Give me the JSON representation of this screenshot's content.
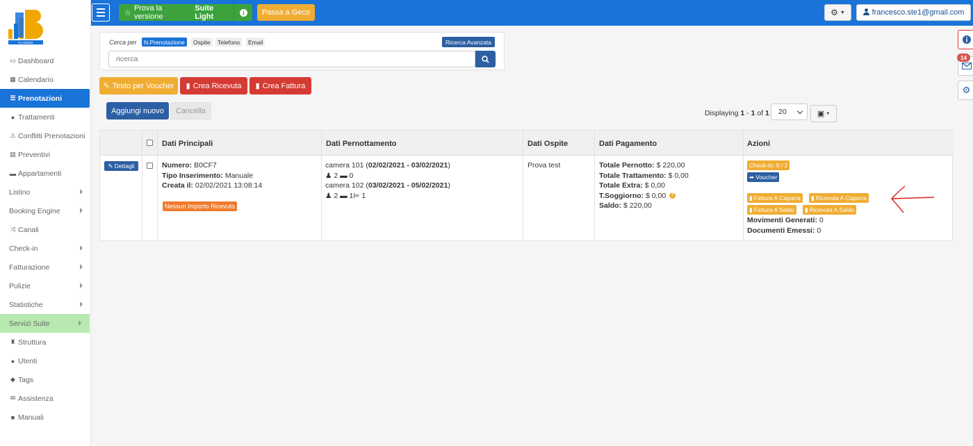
{
  "app": {
    "logo_text": "PLANNER"
  },
  "sidebar": {
    "items": [
      {
        "label": "Dashboard",
        "icon": "monitor-icon"
      },
      {
        "label": "Calendario",
        "icon": "calendar-icon"
      },
      {
        "label": "Prenotazioni",
        "icon": "list-icon",
        "active": true
      },
      {
        "label": "Trattamenti",
        "icon": "apple-icon"
      },
      {
        "label": "Conflitti Prenotazioni",
        "icon": "warning-icon"
      },
      {
        "label": "Preventivi",
        "icon": "document-icon"
      },
      {
        "label": "Appartamenti",
        "icon": "bed-icon"
      },
      {
        "label": "Listino",
        "submenu": true
      },
      {
        "label": "Booking Engine",
        "submenu": true
      },
      {
        "label": "Canali",
        "icon": "shuffle-icon"
      },
      {
        "label": "Check-in",
        "submenu": true
      },
      {
        "label": "Fatturazione",
        "submenu": true
      },
      {
        "label": "Pulizie",
        "submenu": true
      },
      {
        "label": "Statistiche",
        "submenu": true
      },
      {
        "label": "Servizi Suite",
        "submenu": true,
        "highlight": true
      },
      {
        "label": "Struttura",
        "icon": "tower-icon"
      },
      {
        "label": "Utenti",
        "icon": "user-icon"
      },
      {
        "label": "Tags",
        "icon": "tags-icon"
      },
      {
        "label": "Assistenza",
        "icon": "envelope-icon"
      },
      {
        "label": "Manuali",
        "icon": "book-icon"
      }
    ]
  },
  "topbar": {
    "try_prefix": "Prova la versione",
    "try_bold": "Suite Light",
    "geco_label": "Passa a Geco",
    "user_email": "francesco.ste1@gmail.com"
  },
  "right_panel": {
    "mail_badge": "14"
  },
  "search": {
    "cerca_label": "Cerca per",
    "filters": [
      "N.Prenotazione",
      "Ospite",
      "Telefono",
      "Email"
    ],
    "active_filter": "N.Prenotazione",
    "advanced_label": "Ricerca Avanzata",
    "placeholder": "ricerca"
  },
  "actions": {
    "voucher_text": "Testo per Voucher",
    "crea_ricevuta": "Crea Ricevuta",
    "crea_fattura": "Crea Fattura",
    "aggiungi": "Aggiungi nuovo",
    "cancella": "Cancella"
  },
  "pagination": {
    "prefix": "Displaying",
    "from": "1",
    "sep": " - ",
    "to": "1",
    "of_label": " of ",
    "total": "1",
    "per_page": "20"
  },
  "table": {
    "headers": [
      "Dati Principali",
      "Dati Pernottamento",
      "Dati Ospite",
      "Dati Pagamento",
      "Azioni"
    ],
    "row": {
      "dettagli_label": "Dettagli",
      "numero_label": "Numero:",
      "numero": "B0CF7",
      "tipo_label": "Tipo Inserimento:",
      "tipo": "Manuale",
      "creata_label": "Creata il:",
      "creata": "02/02/2021 13:08:14",
      "nessun_importo": "Nessun Importo Ricevuto",
      "camera1": "camera 101 (",
      "camera1_dates": "02/02/2021 - 03/02/2021",
      "camera1_close": ")",
      "camera1_guests": "2",
      "camera1_beds": "0",
      "camera2": "camera 102 (",
      "camera2_dates": "03/02/2021 - 05/02/2021",
      "camera2_close": ")",
      "camera2_guests": "2",
      "camera2_beds": "1",
      "camera2_extra": "1",
      "ospite": "Prova test",
      "totale_pernotto_label": "Totale Pernotto:",
      "totale_pernotto": "$ 220,00",
      "totale_trattamento_label": "Totale Trattamento:",
      "totale_trattamento": "$ 0,00",
      "totale_extra_label": "Totale Extra:",
      "totale_extra": "$ 0,00",
      "soggiorno_label": "T.Soggiorno:",
      "soggiorno": "$ 0,00",
      "saldo_label": "Saldo:",
      "saldo": "$ 220,00",
      "checkin_badge": "Check-In: 0 / 2",
      "voucher_badge": "Voucher",
      "fattura_caparra": "Fattura A Caparra",
      "ricevuta_caparra": "Ricevuta A Caparra",
      "fattura_saldo": "Fattura A Saldo",
      "ricevuta_saldo": "Ricevuta A Saldo",
      "movimenti_label": "Movimenti Generati:",
      "movimenti": "0",
      "documenti_label": "Documenti Emessi:",
      "documenti": "0"
    }
  },
  "colors": {
    "primary": "#1a73d8",
    "green": "#3ca33c",
    "orange": "#f0ad32",
    "red": "#d53a33",
    "navy": "#2c5fa3",
    "annotation_red": "#e02020"
  }
}
